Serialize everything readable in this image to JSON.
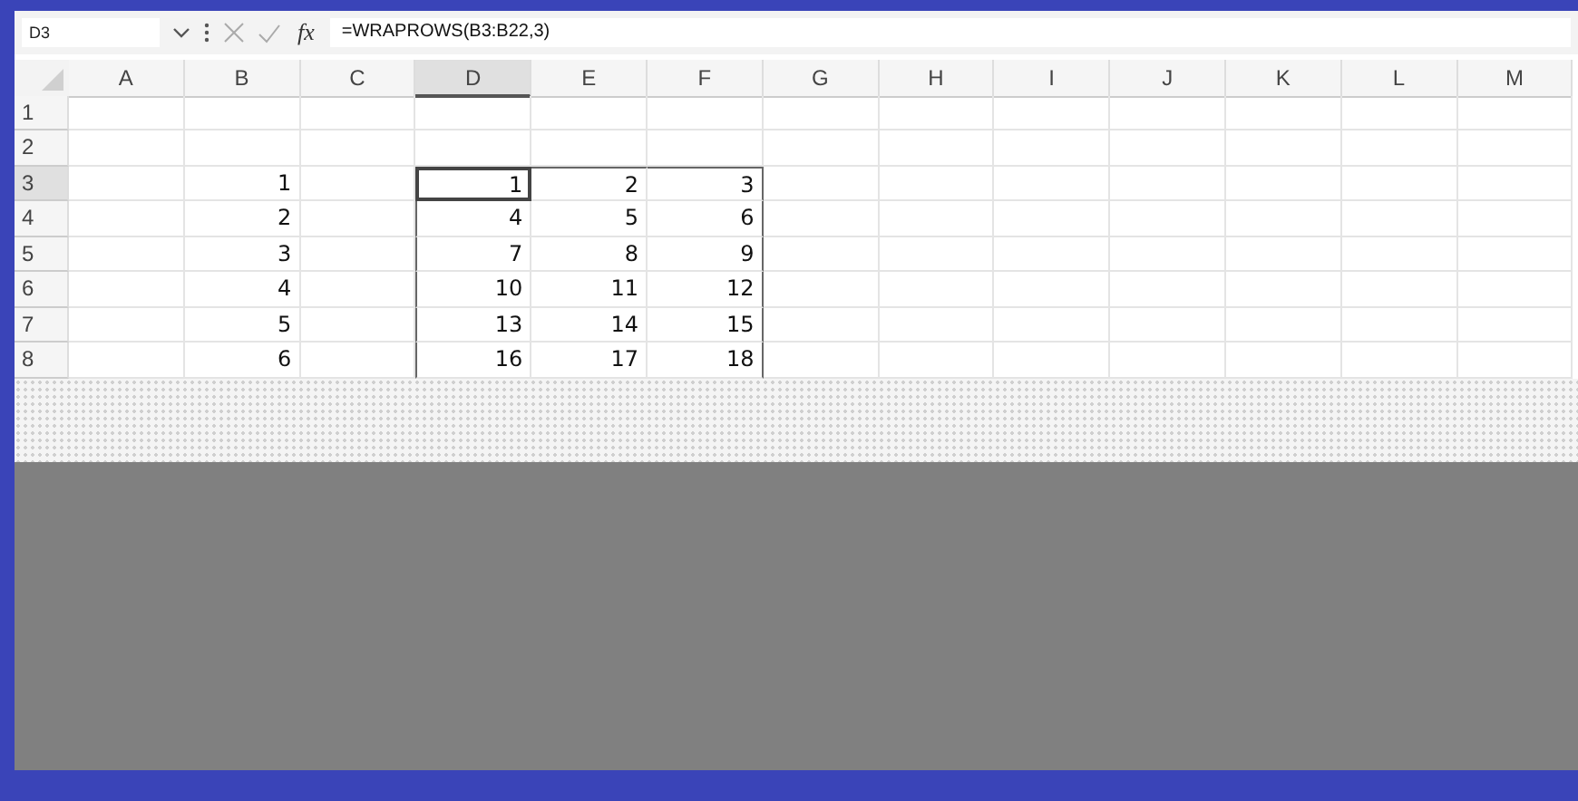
{
  "formula_bar": {
    "name_box": "D3",
    "function_label": "fx",
    "formula": "=WRAPROWS(B3:B22,3)"
  },
  "columns": [
    {
      "label": "A",
      "selected": false
    },
    {
      "label": "B",
      "selected": false
    },
    {
      "label": "C",
      "selected": false
    },
    {
      "label": "D",
      "selected": true
    },
    {
      "label": "E",
      "selected": false
    },
    {
      "label": "F",
      "selected": false
    },
    {
      "label": "G",
      "selected": false
    },
    {
      "label": "H",
      "selected": false
    },
    {
      "label": "I",
      "selected": false
    },
    {
      "label": "J",
      "selected": false
    },
    {
      "label": "K",
      "selected": false
    },
    {
      "label": "L",
      "selected": false
    },
    {
      "label": "M",
      "selected": false
    }
  ],
  "rows": [
    {
      "label": "1",
      "selected": false,
      "cells": [
        null,
        null,
        null,
        null,
        null,
        null,
        null,
        null,
        null,
        null,
        null,
        null,
        null
      ]
    },
    {
      "label": "2",
      "selected": false,
      "cells": [
        null,
        null,
        null,
        null,
        null,
        null,
        null,
        null,
        null,
        null,
        null,
        null,
        null
      ]
    },
    {
      "label": "3",
      "selected": true,
      "cells": [
        null,
        "1",
        null,
        "1",
        "2",
        "3",
        null,
        null,
        null,
        null,
        null,
        null,
        null
      ]
    },
    {
      "label": "4",
      "selected": false,
      "cells": [
        null,
        "2",
        null,
        "4",
        "5",
        "6",
        null,
        null,
        null,
        null,
        null,
        null,
        null
      ]
    },
    {
      "label": "5",
      "selected": false,
      "cells": [
        null,
        "3",
        null,
        "7",
        "8",
        "9",
        null,
        null,
        null,
        null,
        null,
        null,
        null
      ]
    },
    {
      "label": "6",
      "selected": false,
      "cells": [
        null,
        "4",
        null,
        "10",
        "11",
        "12",
        null,
        null,
        null,
        null,
        null,
        null,
        null
      ]
    },
    {
      "label": "7",
      "selected": false,
      "cells": [
        null,
        "5",
        null,
        "13",
        "14",
        "15",
        null,
        null,
        null,
        null,
        null,
        null,
        null
      ]
    },
    {
      "label": "8",
      "selected": false,
      "cells": [
        null,
        "6",
        null,
        "16",
        "17",
        "18",
        null,
        null,
        null,
        null,
        null,
        null,
        null
      ]
    }
  ]
}
